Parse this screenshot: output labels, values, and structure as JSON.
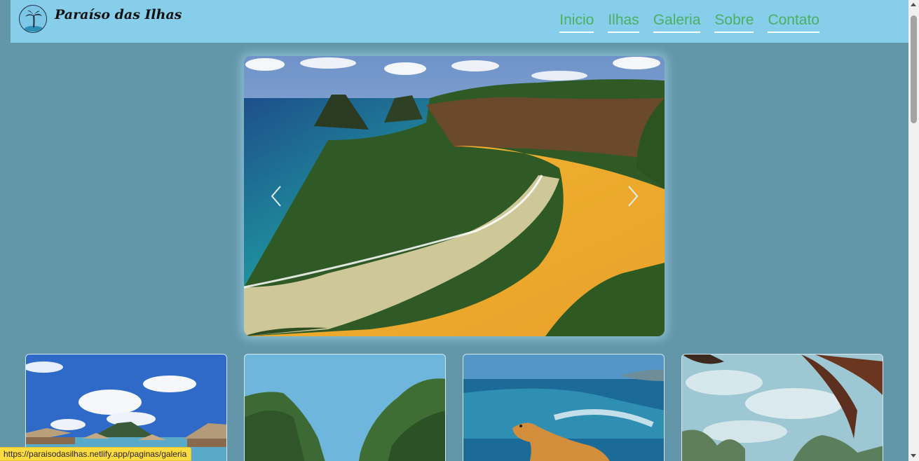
{
  "header": {
    "brand": "Paraíso das Ilhas",
    "logo_icon": "palm-tree-icon",
    "nav": [
      {
        "label": "Inicio"
      },
      {
        "label": "Ilhas"
      },
      {
        "label": "Galeria"
      },
      {
        "label": "Sobre"
      },
      {
        "label": "Contato"
      }
    ]
  },
  "carousel": {
    "prev_icon": "chevron-left-icon",
    "next_icon": "chevron-right-icon"
  },
  "gallery": {
    "cards": [
      {
        "icon": "overwater-bungalows-photo"
      },
      {
        "icon": "cliff-lagoon-photo"
      },
      {
        "icon": "iguana-photo"
      },
      {
        "icon": "palm-trees-photo"
      }
    ]
  },
  "status_bar": {
    "url": "https://paraisodasilhas.netlify.app/paginas/galeria"
  },
  "colors": {
    "page_bg": "#6496aa",
    "header_bg": "#87ceeb",
    "nav_link": "#4caf62",
    "status_bg": "#fedb3e"
  }
}
